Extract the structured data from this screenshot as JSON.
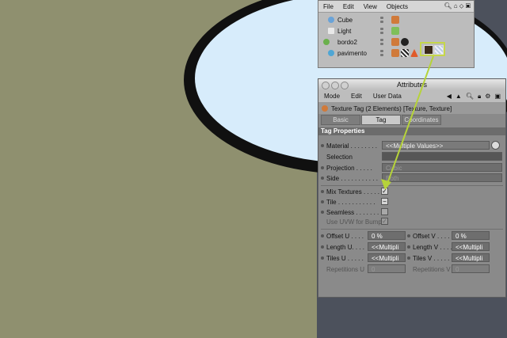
{
  "objects_panel": {
    "menu": [
      "File",
      "Edit",
      "View",
      "Objects"
    ],
    "objects": [
      {
        "name": "Cube",
        "icon_color": "#6aa3d8"
      },
      {
        "name": "Light",
        "icon_color": "#e8e8e8"
      },
      {
        "name": "bordo2",
        "icon_color": "#6ab04c"
      },
      {
        "name": "pavimento",
        "icon_color": "#4fa6d4"
      }
    ]
  },
  "attributes": {
    "title": "Attributes",
    "menu": [
      "Mode",
      "Edit",
      "User Data"
    ],
    "tag_header": "Texture Tag (2 Elements) [Texture, Texture]",
    "tabs": [
      "Basic",
      "Tag",
      "Coordinates"
    ],
    "active_tab": "Tag",
    "section": "Tag Properties",
    "material": {
      "label": "Material . . . . . . . .",
      "value": "<<Multiple Values>>"
    },
    "selection": {
      "label": "Selection"
    },
    "projection": {
      "label": "Projection . . . . .",
      "value": "Cubic"
    },
    "side": {
      "label": "Side . . . . . . . . . . .",
      "value": "Both"
    },
    "mix_textures": {
      "label": "Mix Textures . . . . .",
      "checked": true
    },
    "tile": {
      "label": "Tile . . . . . . . . . . ."
    },
    "seamless": {
      "label": "Seamless . . . . . . ."
    },
    "use_uvw": {
      "label": "Use UVW for Bump"
    },
    "offset_u": {
      "label": "Offset U . . . .",
      "value": "0 %"
    },
    "offset_v": {
      "label": "Offset V . . . .",
      "value": "0 %"
    },
    "length_u": {
      "label": "Length U. . . .",
      "value": "<<Multipli"
    },
    "length_v": {
      "label": "Length V . . . .",
      "value": "<<Multipli"
    },
    "tiles_u": {
      "label": "Tiles U . . . . .",
      "value": "<<Multipli"
    },
    "tiles_v": {
      "label": "Tiles V . . . . .",
      "value": "<<Multipli"
    },
    "repetitions_u": {
      "label": "Repetitions U",
      "value": "0"
    },
    "repetitions_v": {
      "label": "Repetitions V",
      "value": "0"
    }
  },
  "colors": {
    "viewport": "#8f906f",
    "highlight": "#c5d64a",
    "arrow": "#b6d33a"
  }
}
